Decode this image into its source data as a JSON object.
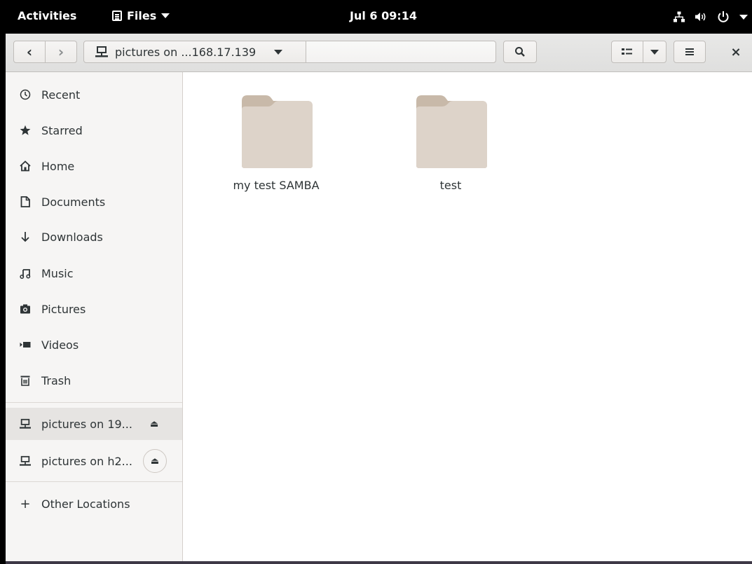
{
  "topbar": {
    "activities": "Activities",
    "app_menu": "Files",
    "clock": "Jul 6  09:14"
  },
  "headerbar": {
    "path_label": "pictures on ...168.17.139"
  },
  "sidebar": {
    "items": [
      {
        "label": "Recent",
        "icon": "clock-icon"
      },
      {
        "label": "Starred",
        "icon": "star-icon"
      },
      {
        "label": "Home",
        "icon": "home-icon"
      },
      {
        "label": "Documents",
        "icon": "document-icon"
      },
      {
        "label": "Downloads",
        "icon": "download-icon"
      },
      {
        "label": "Music",
        "icon": "music-icon"
      },
      {
        "label": "Pictures",
        "icon": "camera-icon"
      },
      {
        "label": "Videos",
        "icon": "video-icon"
      },
      {
        "label": "Trash",
        "icon": "trash-icon"
      }
    ],
    "mounts": [
      {
        "label": "pictures on 19...",
        "icon": "network-drive-icon"
      },
      {
        "label": "pictures on h2...",
        "icon": "network-drive-icon"
      }
    ],
    "other_locations": "Other Locations"
  },
  "content": {
    "folders": [
      {
        "name": "my test SAMBA"
      },
      {
        "name": "test"
      }
    ]
  },
  "colors": {
    "topbar": "#000000",
    "headerbar": "#e4e4e3",
    "sidebar": "#f6f5f4",
    "selected_row": "#e6e4e2",
    "folder_back": "#c8b9a9",
    "folder_front": "#ddd3c9"
  }
}
